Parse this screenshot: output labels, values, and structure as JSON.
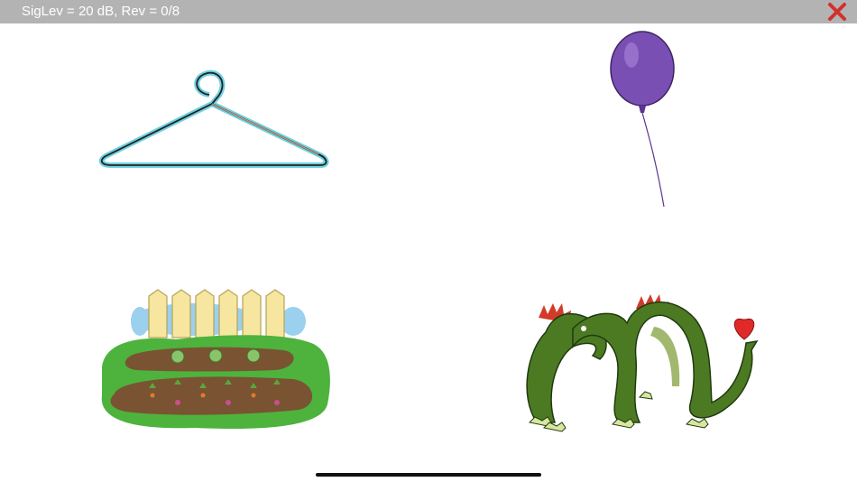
{
  "status_bar": {
    "text": "SigLev = 20 dB, Rev = 0/8",
    "close_icon": "close-x-icon",
    "close_color": "#d32f2f"
  },
  "choices": [
    {
      "icon": "hanger-icon"
    },
    {
      "icon": "balloon-icon"
    },
    {
      "icon": "garden-icon"
    },
    {
      "icon": "dragon-icon"
    }
  ]
}
